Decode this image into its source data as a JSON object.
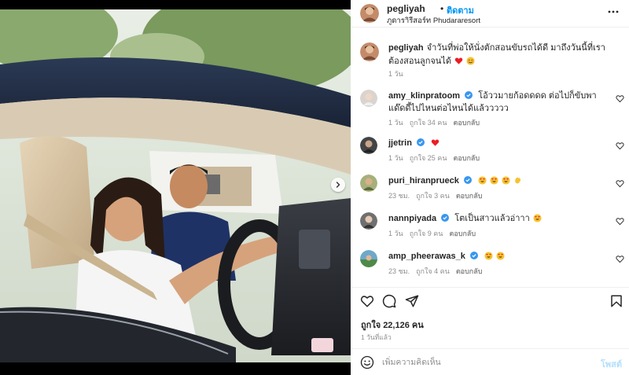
{
  "header": {
    "username": "pegliyah",
    "dot": "•",
    "follow_label": "ติดตาม",
    "location": "ภูดาราิรีสอร์ท Phudararesort"
  },
  "caption": {
    "username": "pegliyah",
    "text": "จำวันที่พ่อให้นั่งตักสอนขับรถได้ดี มาถึงวันนี้ที่เราต้องสอนลูกจนได้",
    "time": "1 วัน"
  },
  "comments": [
    {
      "username": "amy_klinpratoom",
      "verified": true,
      "text": "โอ้ววมายก้อดดดด ต่อไปก็ขับพาแด๊ดดี้ไปไหนต่อไหนได้แล้ววววว",
      "emojis": [],
      "time": "1 วัน",
      "likes": "ถูกใจ 34 คน",
      "reply": "ตอบกลับ"
    },
    {
      "username": "jjetrin",
      "verified": true,
      "text": "",
      "emojis": [
        "heart"
      ],
      "time": "1 วัน",
      "likes": "ถูกใจ 25 คน",
      "reply": "ตอบกลับ"
    },
    {
      "username": "puri_hiranprueck",
      "verified": true,
      "text": "",
      "emojis": [
        "heart-eyes",
        "heart-eyes",
        "heart-eyes",
        "clap"
      ],
      "time": "23 ชม.",
      "likes": "ถูกใจ 3 คน",
      "reply": "ตอบกลับ"
    },
    {
      "username": "nannpiyada",
      "verified": true,
      "text": "โตเป็นสาวแล้วอ่าาา",
      "emojis": [
        "heart-eyes"
      ],
      "time": "1 วัน",
      "likes": "ถูกใจ 9 คน",
      "reply": "ตอบกลับ"
    },
    {
      "username": "amp_pheerawas_k",
      "verified": true,
      "text": "",
      "emojis": [
        "heart-eyes",
        "heart-eyes"
      ],
      "time": "23 ชม.",
      "likes": "ถูกใจ 4 คน",
      "reply": "ตอบกลับ"
    }
  ],
  "actions": {
    "likes_label": "ถูกใจ 22,126 คน",
    "posted_time": "1 วันที่แล้ว"
  },
  "add_comment": {
    "placeholder": "เพิ่มความคิดเห็น",
    "post_label": "โพสต์"
  },
  "colors": {
    "accent": "#0095f6",
    "text": "#262626",
    "muted": "#8e8e8e",
    "border": "#efefef",
    "heart_red": "#ed4956",
    "post_disabled": "#b2dffc"
  },
  "icons": {
    "more": "more-horizontal-icon",
    "like": "heart-outline-icon",
    "comment": "comment-bubble-icon",
    "share": "paper-plane-icon",
    "save": "bookmark-icon",
    "emoji": "smiley-icon",
    "verified": "verified-badge-icon",
    "carousel": "chevron-right-icon"
  }
}
